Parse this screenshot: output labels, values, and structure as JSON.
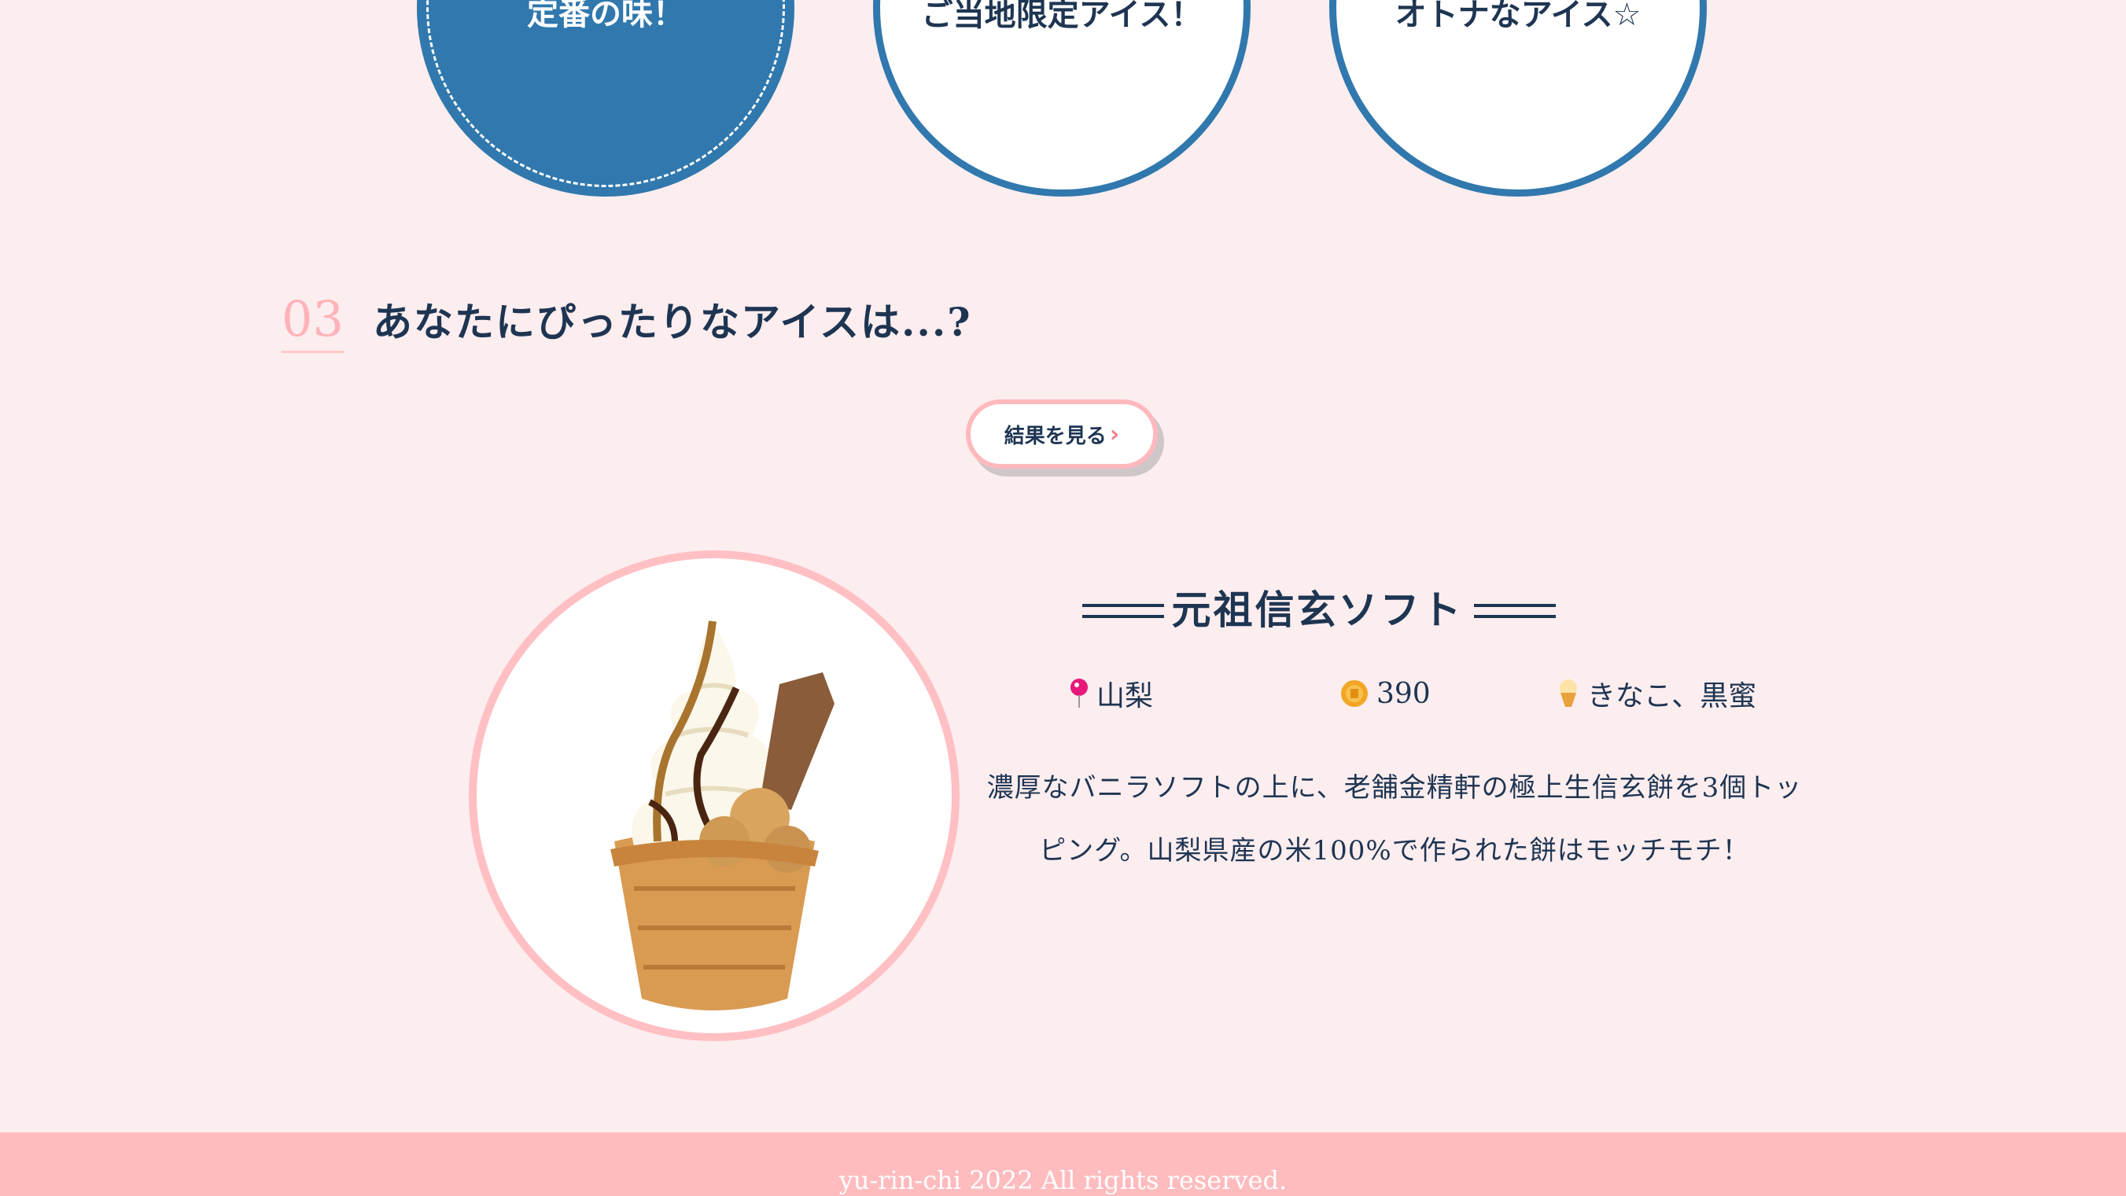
{
  "categories": [
    {
      "label": "定番の味！"
    },
    {
      "label": "ご当地限定アイス！"
    },
    {
      "label": "オトナなアイス☆"
    }
  ],
  "section": {
    "number": "03",
    "title": "あなたにぴったりなアイスは...?"
  },
  "result_button": {
    "label": "結果を見る",
    "chevron": "›"
  },
  "product": {
    "name": "元祖信玄ソフト",
    "region_icon": "map-pin-icon",
    "region": "山梨",
    "price_icon": "coin-icon",
    "price": "390",
    "topping_icon": "ice-cream-icon",
    "topping": "きなこ、黒蜜",
    "description": "濃厚なバニラソフトの上に、老舗金精軒の極上生信玄餅を3個トッピング。山梨県産の米100%で作られた餅はモッチモチ！"
  },
  "footer": {
    "copyright": "yu-rin-chi 2022 All rights reserved."
  },
  "colors": {
    "blue": "#3078ad",
    "pink": "#ffbcbf",
    "navy": "#1e3552",
    "background": "#fcedef"
  }
}
